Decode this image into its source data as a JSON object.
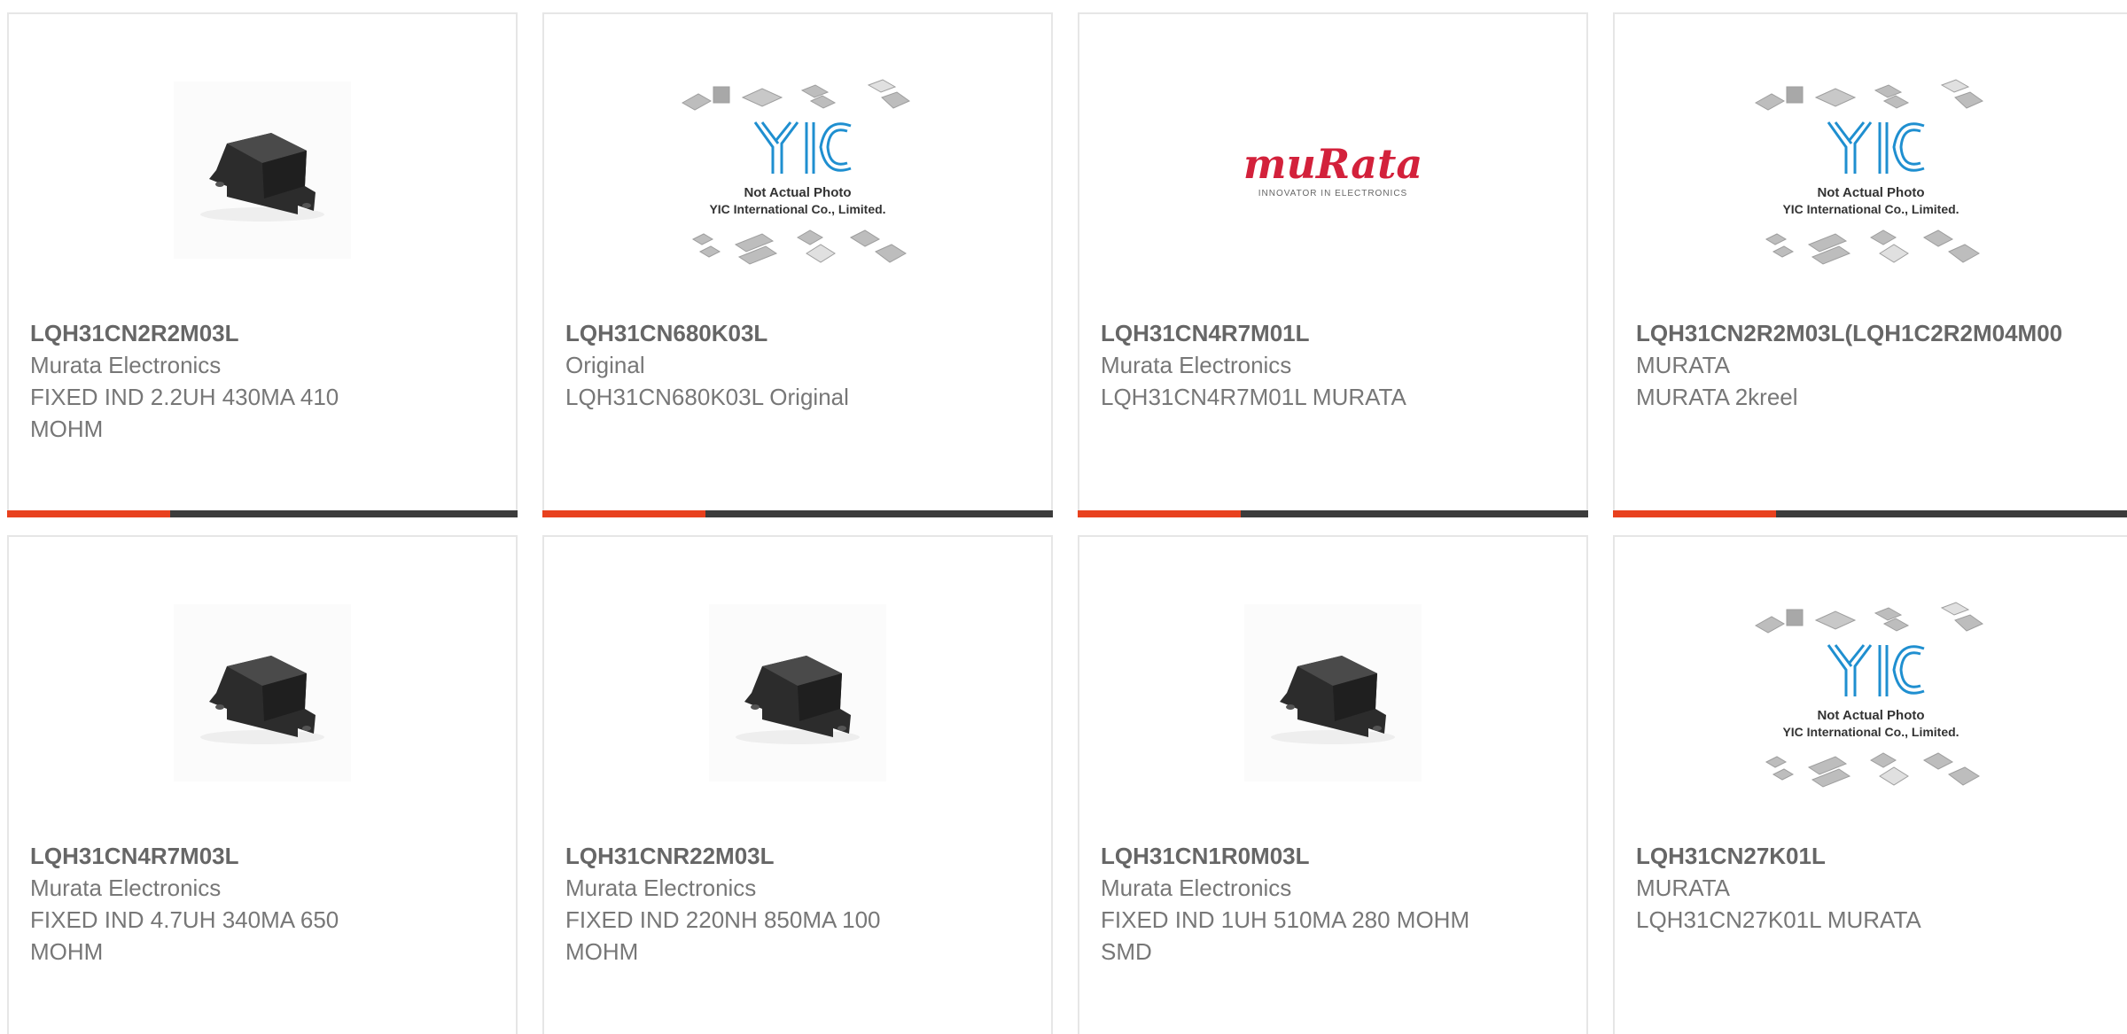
{
  "products": [
    {
      "part_number": "LQH31CN2R2M03L",
      "manufacturer": "Murata Electronics",
      "description": "FIXED IND 2.2UH 430MA 410 MOHM",
      "image": "inductor-photo"
    },
    {
      "part_number": "LQH31CN680K03L",
      "manufacturer": "Original",
      "description": "LQH31CN680K03L Original",
      "image": "yic-placeholder"
    },
    {
      "part_number": "LQH31CN4R7M01L",
      "manufacturer": "Murata Electronics",
      "description": "LQH31CN4R7M01L MURATA",
      "image": "murata-logo"
    },
    {
      "part_number": "LQH31CN2R2M03L(LQH1C2R2M04M00",
      "manufacturer": "MURATA",
      "description": "MURATA 2kreel",
      "image": "yic-placeholder"
    },
    {
      "part_number": "LQH31CN4R7M03L",
      "manufacturer": "Murata Electronics",
      "description": "FIXED IND 4.7UH 340MA 650 MOHM",
      "image": "inductor-photo"
    },
    {
      "part_number": "LQH31CNR22M03L",
      "manufacturer": "Murata Electronics",
      "description": "FIXED IND 220NH 850MA 100 MOHM",
      "image": "inductor-photo"
    },
    {
      "part_number": "LQH31CN1R0M03L",
      "manufacturer": "Murata Electronics",
      "description": "FIXED IND 1UH 510MA 280 MOHM SMD",
      "image": "inductor-photo"
    },
    {
      "part_number": "LQH31CN27K01L",
      "manufacturer": "MURATA",
      "description": "LQH31CN27K01L MURATA",
      "image": "yic-placeholder"
    }
  ],
  "placeholder": {
    "line1": "Not Actual Photo",
    "line2": "YIC International Co., Limited.",
    "logo_text": "YIC"
  },
  "murata_logo": {
    "word": "muRata",
    "tagline": "INNOVATOR IN ELECTRONICS"
  },
  "colors": {
    "accent": "#e8411e",
    "bar": "#3c3c3c",
    "border": "#e6e6e6",
    "murata_red": "#d3213b",
    "yic_blue": "#1f8fd0"
  }
}
